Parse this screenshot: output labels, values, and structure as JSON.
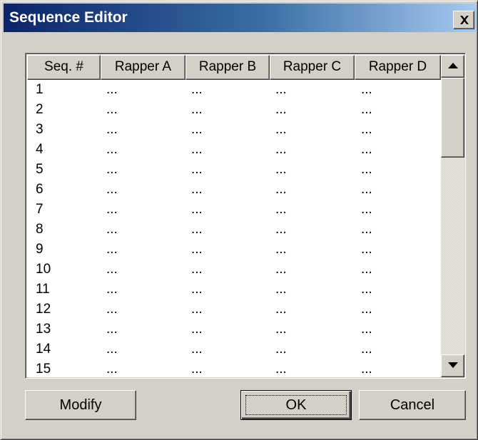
{
  "window": {
    "title": "Sequence Editor"
  },
  "grid": {
    "columns": [
      "Seq. #",
      "Rapper A",
      "Rapper B",
      "Rapper C",
      "Rapper D"
    ],
    "rows": [
      [
        "1",
        "...",
        "...",
        "...",
        "..."
      ],
      [
        "2",
        "...",
        "...",
        "...",
        "..."
      ],
      [
        "3",
        "...",
        "...",
        "...",
        "..."
      ],
      [
        "4",
        "...",
        "...",
        "...",
        "..."
      ],
      [
        "5",
        "...",
        "...",
        "...",
        "..."
      ],
      [
        "6",
        "...",
        "...",
        "...",
        "..."
      ],
      [
        "7",
        "...",
        "...",
        "...",
        "..."
      ],
      [
        "8",
        "...",
        "...",
        "...",
        "..."
      ],
      [
        "9",
        "...",
        "...",
        "...",
        "..."
      ],
      [
        "10",
        "...",
        "...",
        "...",
        "..."
      ],
      [
        "11",
        "...",
        "...",
        "...",
        "..."
      ],
      [
        "12",
        "...",
        "...",
        "...",
        "..."
      ],
      [
        "13",
        "...",
        "...",
        "...",
        "..."
      ],
      [
        "14",
        "...",
        "...",
        "...",
        "..."
      ],
      [
        "15",
        "...",
        "...",
        "...",
        "..."
      ]
    ]
  },
  "buttons": {
    "modify": "Modify",
    "ok": "OK",
    "cancel": "Cancel"
  },
  "icons": {
    "close": "close-icon",
    "scroll_up": "arrow-up-icon",
    "scroll_down": "arrow-down-icon"
  }
}
